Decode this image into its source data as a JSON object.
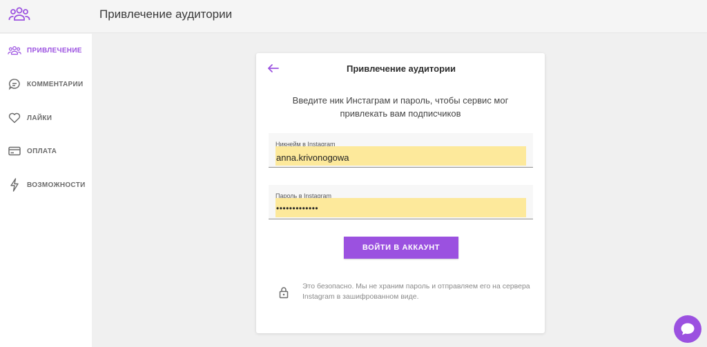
{
  "header": {
    "title": "Привлечение аудитории",
    "logo_icon": "users-group-icon"
  },
  "sidebar": {
    "items": [
      {
        "label": "ПРИВЛЕЧЕНИЕ",
        "icon": "users-group-icon",
        "active": true
      },
      {
        "label": "КОММЕНТАРИИ",
        "icon": "comment-icon",
        "active": false
      },
      {
        "label": "ЛАЙКИ",
        "icon": "heart-icon",
        "active": false
      },
      {
        "label": "ОПЛАТА",
        "icon": "credit-card-icon",
        "active": false
      },
      {
        "label": "ВОЗМОЖНОСТИ",
        "icon": "lightning-icon",
        "active": false
      }
    ]
  },
  "card": {
    "title": "Привлечение аудитории",
    "description": "Введите ник Инстаграм и пароль, чтобы сервис мог привлекать вам подписчиков",
    "username": {
      "label": "Никнейм в Instagram",
      "value": "anna.krivonogowa"
    },
    "password": {
      "label": "Пароль в Instagram",
      "value": "•••••••••••••"
    },
    "login_button": "ВОЙТИ В АККАУНТ",
    "security_note": "Это безопасно. Мы не храним пароль и отправляем его на сервера Instagram в зашифрованном виде."
  },
  "colors": {
    "accent": "#9b51e0",
    "autofill": "#fde99b",
    "background": "#f0f0f0"
  }
}
